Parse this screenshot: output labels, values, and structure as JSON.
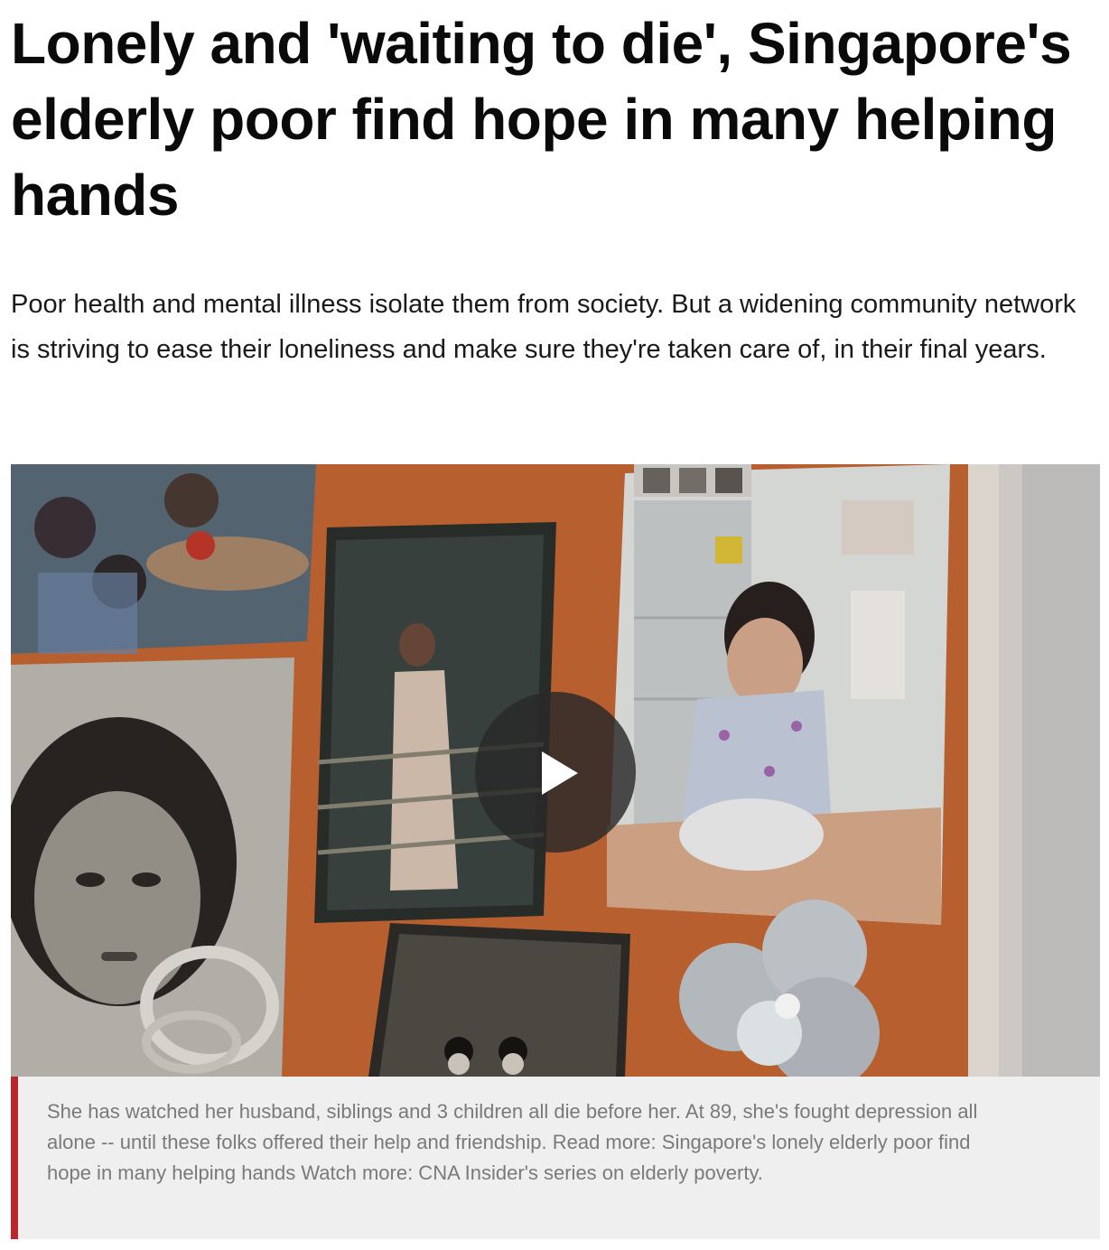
{
  "article": {
    "headline": "Lonely and 'waiting to die', Singapore's elderly poor find hope in many helping hands",
    "summary": "Poor health and mental illness isolate them from society. But a widening community network is striving to ease their loneliness and make sure they're taken care of, in their final years."
  },
  "video": {
    "play_icon": "play-icon",
    "caption": "She has watched her husband, siblings and 3 children all die before her. At 89, she's fought depression all alone -- until these folks offered their help and friendship. Read more: Singapore's lonely elderly poor find hope in many helping hands Watch more: CNA Insider's series  on elderly poverty."
  },
  "colors": {
    "caption_accent": "#b9262d",
    "caption_background": "#efefef",
    "caption_text": "#7a7a7a",
    "board_orange": "#c86a3a"
  }
}
